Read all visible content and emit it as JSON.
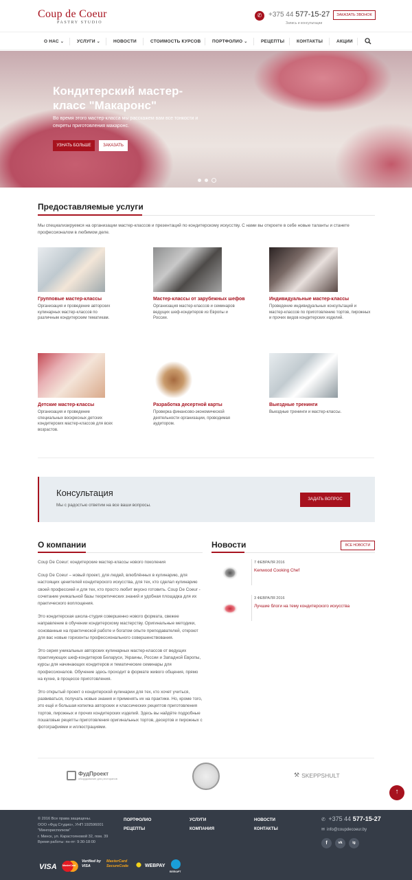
{
  "brand": {
    "name": "Coup de Coeur",
    "tagline": "PASTRY STUDIO",
    "accent": "#a7121e"
  },
  "header": {
    "phone_prefix": "+375 44",
    "phone_number": "577-15-27",
    "phone_sub": "Запись и консультации",
    "call_button": "ЗАКАЗАТЬ ЗВОНОК"
  },
  "nav": {
    "items": [
      {
        "label": "О НАС",
        "dropdown": "⌄"
      },
      {
        "label": "УСЛУГИ",
        "dropdown": "⌄"
      },
      {
        "label": "НОВОСТИ"
      },
      {
        "label": "СТОИМОСТЬ КУРСОВ"
      },
      {
        "label": "ПОРТФОЛИО",
        "dropdown": "⌄"
      },
      {
        "label": "РЕЦЕПТЫ"
      },
      {
        "label": "КОНТАКТЫ"
      },
      {
        "label": "АКЦИИ"
      }
    ]
  },
  "hero": {
    "title": "Кондитерский мастер-класс \"Макаронс\"",
    "text": "Во время этого мастер-класса мы расскажем вам все тонкости и секреты приготовления макаронс.",
    "btn_more": "УЗНАТЬ БОЛЬШЕ",
    "btn_order": "ЗАКАЗАТЬ"
  },
  "services": {
    "title": "Предоставляемые услуги",
    "intro": "Мы специализируемся на организации мастер-классов и презентаций по кондитерскому искусству. С нами вы откроете в себе новые таланты и станете профессионалом в любимом деле.",
    "items": [
      {
        "title": "Групповые мастер-классы",
        "desc": "Организация и проведение авторских кулинарных мастер-классов по различным кондитерским тематикам."
      },
      {
        "title": "Мастер-классы от зарубежных шефов",
        "desc": "Организация мастер-классов и семинаров ведущих шеф-кондитеров из Европы и России."
      },
      {
        "title": "Индивидуальные мастер-классы",
        "desc": "Проведение индивидуальных консультаций и мастер-классов по приготовлению тортов, пирожных и прочих видов кондитерских изделий."
      },
      {
        "title": "Детские мастер-классы",
        "desc": "Организация и проведение специальных воскресных детских кондитерских мастер-классов для всех возрастов."
      },
      {
        "title": "Разработка десертной карты",
        "desc": "Проверка финансово-экономической деятельности организации, проводимая аудитором."
      },
      {
        "title": "Выездные тренинги",
        "desc": "Выездные тренинги и мастер-классы."
      }
    ]
  },
  "consult": {
    "title": "Консультация",
    "subtitle": "Мы с радостью ответим на все ваши вопросы.",
    "button": "ЗАДАТЬ ВОПРОС"
  },
  "about": {
    "title": "О компании",
    "paragraphs": [
      "Coup De Coeur: кондитерские мастер-классы нового поколения",
      "Coup De Coeur – новый проект, для людей, влюблённых в кулинарию, для настоящих ценителей кондитерского искусства, для тех, кто сделал кулинарию своей профессией и для тех, кто просто любит вкусно готовить. Coup De Coeur - сочетание уникальной базы теоретических знаний и удобная площадка для их практического воплощения.",
      "Это кондитерская школа-студия совершенно нового формата, свежее направление в обучении кондитерскому мастерству. Оригинальные методики, основанные на практической работе и богатом опыте преподавателей, откроют для вас новые горизонты профессионального совершенствования.",
      "Это серия уникальных авторских кулинарных мастер-классов от ведущих практикующих шеф-кондитеров Беларуси, Украины, России и Западной Европы, курсы для начинающих кондитеров и тематические семинары для профессионалов. Обучение здесь проходит в формате живого общения, прямо на кухне, в процессе приготовления.",
      "Это открытый проект о кондитерской кулинарии для тех, кто хочет учиться, развиваться, получать новые знания и применять их на практике. Но, кроме того, это ещё и большая копилка авторских и классических рецептов приготовления тортов, пирожных и прочих кондитерских изделий. Здесь вы найдёте подробные пошаговые рецепты приготовления оригинальных тортов, десертов и пирожных с фотографиями и иллюстрациями."
    ]
  },
  "news": {
    "title": "Новости",
    "all_button": "ВСЕ НОВОСТИ",
    "items": [
      {
        "date": "7 ФЕВРАЛЯ 2016",
        "title": "Kenwood Cooking Chef"
      },
      {
        "date": "3 ФЕВРАЛЯ 2016",
        "title": "Лучшие блоги на тему кондитерского искусства"
      }
    ]
  },
  "partners": {
    "fudproekt": "ФудПроект",
    "fudproekt_sub": "оборудование для ресторанов",
    "skeppshult": "SKEPPSHULT"
  },
  "scroll_top": "↑",
  "footer": {
    "copyright": "© 2016 Все права защищены.",
    "company": "ООО «Фуд Студио», УНП 192596001",
    "reg": "\"Мингорисполком\"",
    "address": "г. Минск, ул. Карастояновой 32, пом. 39",
    "hours": "Время работы: пн-пт: 9:30-18:00",
    "links": [
      "ПОРТФОЛИО",
      "УСЛУГИ",
      "НОВОСТИ",
      "РЕЦЕПТЫ",
      "КОМПАНИЯ",
      "КОНТАКТЫ"
    ],
    "phone_prefix": "+375 44",
    "phone_number": "577-15-27",
    "email": "info@coupdecoeur.by",
    "social": [
      "f",
      "vk",
      "ig"
    ],
    "payments": {
      "visa": "VISA",
      "mastercard": "MasterCard",
      "verified": "Verified by VISA",
      "securecode": "MasterCard SecureCode",
      "webpay": "WEBPAY",
      "belkart": "БЕЛКАРТ"
    }
  }
}
